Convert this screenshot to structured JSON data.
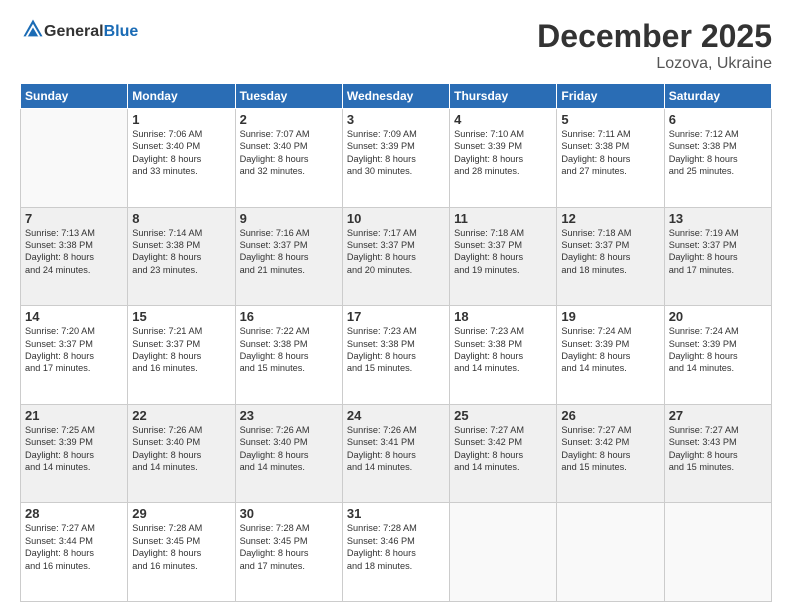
{
  "logo": {
    "general": "General",
    "blue": "Blue"
  },
  "title": "December 2025",
  "location": "Lozova, Ukraine",
  "days_header": [
    "Sunday",
    "Monday",
    "Tuesday",
    "Wednesday",
    "Thursday",
    "Friday",
    "Saturday"
  ],
  "weeks": [
    [
      {
        "day": "",
        "info": ""
      },
      {
        "day": "1",
        "info": "Sunrise: 7:06 AM\nSunset: 3:40 PM\nDaylight: 8 hours\nand 33 minutes."
      },
      {
        "day": "2",
        "info": "Sunrise: 7:07 AM\nSunset: 3:40 PM\nDaylight: 8 hours\nand 32 minutes."
      },
      {
        "day": "3",
        "info": "Sunrise: 7:09 AM\nSunset: 3:39 PM\nDaylight: 8 hours\nand 30 minutes."
      },
      {
        "day": "4",
        "info": "Sunrise: 7:10 AM\nSunset: 3:39 PM\nDaylight: 8 hours\nand 28 minutes."
      },
      {
        "day": "5",
        "info": "Sunrise: 7:11 AM\nSunset: 3:38 PM\nDaylight: 8 hours\nand 27 minutes."
      },
      {
        "day": "6",
        "info": "Sunrise: 7:12 AM\nSunset: 3:38 PM\nDaylight: 8 hours\nand 25 minutes."
      }
    ],
    [
      {
        "day": "7",
        "info": "Sunrise: 7:13 AM\nSunset: 3:38 PM\nDaylight: 8 hours\nand 24 minutes."
      },
      {
        "day": "8",
        "info": "Sunrise: 7:14 AM\nSunset: 3:38 PM\nDaylight: 8 hours\nand 23 minutes."
      },
      {
        "day": "9",
        "info": "Sunrise: 7:16 AM\nSunset: 3:37 PM\nDaylight: 8 hours\nand 21 minutes."
      },
      {
        "day": "10",
        "info": "Sunrise: 7:17 AM\nSunset: 3:37 PM\nDaylight: 8 hours\nand 20 minutes."
      },
      {
        "day": "11",
        "info": "Sunrise: 7:18 AM\nSunset: 3:37 PM\nDaylight: 8 hours\nand 19 minutes."
      },
      {
        "day": "12",
        "info": "Sunrise: 7:18 AM\nSunset: 3:37 PM\nDaylight: 8 hours\nand 18 minutes."
      },
      {
        "day": "13",
        "info": "Sunrise: 7:19 AM\nSunset: 3:37 PM\nDaylight: 8 hours\nand 17 minutes."
      }
    ],
    [
      {
        "day": "14",
        "info": "Sunrise: 7:20 AM\nSunset: 3:37 PM\nDaylight: 8 hours\nand 17 minutes."
      },
      {
        "day": "15",
        "info": "Sunrise: 7:21 AM\nSunset: 3:37 PM\nDaylight: 8 hours\nand 16 minutes."
      },
      {
        "day": "16",
        "info": "Sunrise: 7:22 AM\nSunset: 3:38 PM\nDaylight: 8 hours\nand 15 minutes."
      },
      {
        "day": "17",
        "info": "Sunrise: 7:23 AM\nSunset: 3:38 PM\nDaylight: 8 hours\nand 15 minutes."
      },
      {
        "day": "18",
        "info": "Sunrise: 7:23 AM\nSunset: 3:38 PM\nDaylight: 8 hours\nand 14 minutes."
      },
      {
        "day": "19",
        "info": "Sunrise: 7:24 AM\nSunset: 3:39 PM\nDaylight: 8 hours\nand 14 minutes."
      },
      {
        "day": "20",
        "info": "Sunrise: 7:24 AM\nSunset: 3:39 PM\nDaylight: 8 hours\nand 14 minutes."
      }
    ],
    [
      {
        "day": "21",
        "info": "Sunrise: 7:25 AM\nSunset: 3:39 PM\nDaylight: 8 hours\nand 14 minutes."
      },
      {
        "day": "22",
        "info": "Sunrise: 7:26 AM\nSunset: 3:40 PM\nDaylight: 8 hours\nand 14 minutes."
      },
      {
        "day": "23",
        "info": "Sunrise: 7:26 AM\nSunset: 3:40 PM\nDaylight: 8 hours\nand 14 minutes."
      },
      {
        "day": "24",
        "info": "Sunrise: 7:26 AM\nSunset: 3:41 PM\nDaylight: 8 hours\nand 14 minutes."
      },
      {
        "day": "25",
        "info": "Sunrise: 7:27 AM\nSunset: 3:42 PM\nDaylight: 8 hours\nand 14 minutes."
      },
      {
        "day": "26",
        "info": "Sunrise: 7:27 AM\nSunset: 3:42 PM\nDaylight: 8 hours\nand 15 minutes."
      },
      {
        "day": "27",
        "info": "Sunrise: 7:27 AM\nSunset: 3:43 PM\nDaylight: 8 hours\nand 15 minutes."
      }
    ],
    [
      {
        "day": "28",
        "info": "Sunrise: 7:27 AM\nSunset: 3:44 PM\nDaylight: 8 hours\nand 16 minutes."
      },
      {
        "day": "29",
        "info": "Sunrise: 7:28 AM\nSunset: 3:45 PM\nDaylight: 8 hours\nand 16 minutes."
      },
      {
        "day": "30",
        "info": "Sunrise: 7:28 AM\nSunset: 3:45 PM\nDaylight: 8 hours\nand 17 minutes."
      },
      {
        "day": "31",
        "info": "Sunrise: 7:28 AM\nSunset: 3:46 PM\nDaylight: 8 hours\nand 18 minutes."
      },
      {
        "day": "",
        "info": ""
      },
      {
        "day": "",
        "info": ""
      },
      {
        "day": "",
        "info": ""
      }
    ]
  ]
}
